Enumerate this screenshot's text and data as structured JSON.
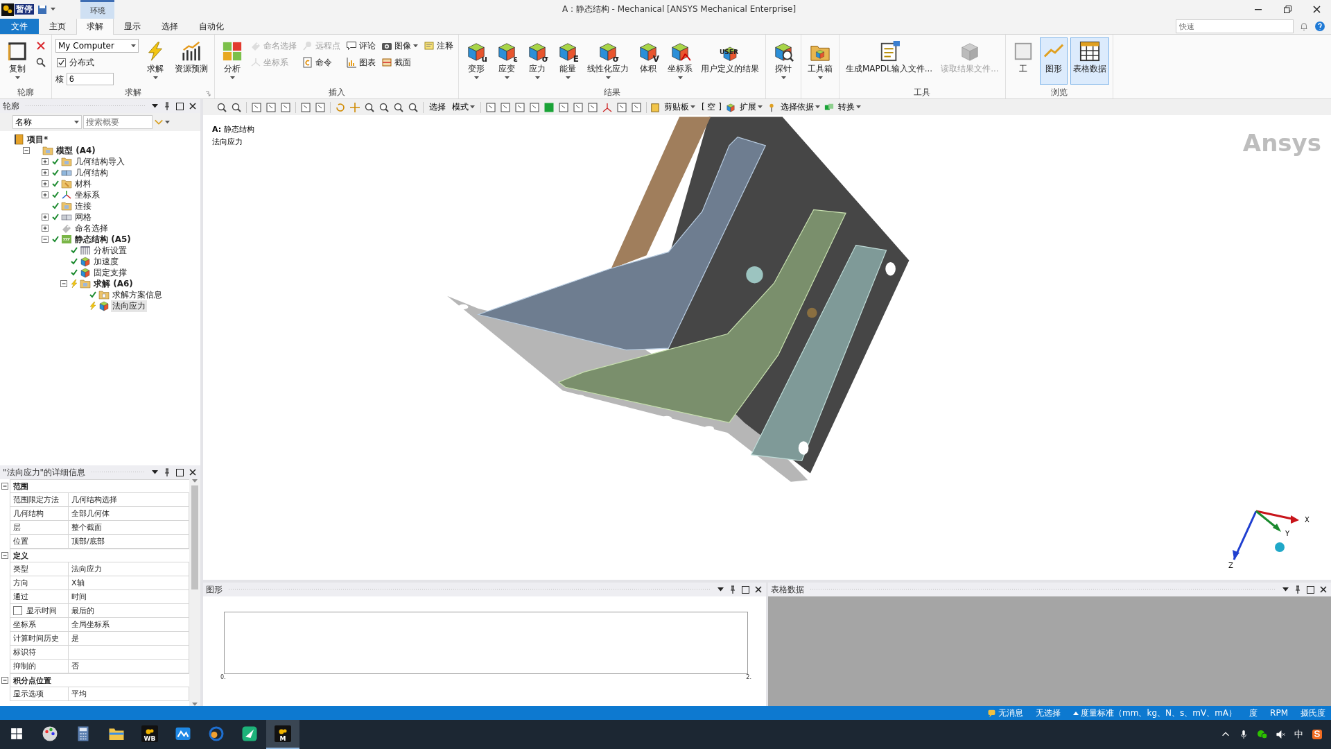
{
  "window": {
    "title": "A : 静态结构 - Mechanical [ANSYS Mechanical Enterprise]",
    "overlay_label": "暂停",
    "context_tab": "环境"
  },
  "ribbon_tabs": [
    {
      "label": "文件",
      "kind": "file",
      "selected": false
    },
    {
      "label": "主页",
      "kind": "tab",
      "selected": false
    },
    {
      "label": "求解",
      "kind": "tab",
      "selected": true
    },
    {
      "label": "显示",
      "kind": "tab",
      "selected": false
    },
    {
      "label": "选择",
      "kind": "tab",
      "selected": false
    },
    {
      "label": "自动化",
      "kind": "tab",
      "selected": false
    }
  ],
  "quick_search": {
    "placeholder": "快速"
  },
  "ribbon_groups": [
    {
      "title": "轮廓",
      "items": [
        {
          "kind": "large",
          "label": "复制",
          "caret": true,
          "disabled": false
        },
        {
          "kind": "stack",
          "items": [
            {
              "kind": "small",
              "disabled": false
            },
            {
              "kind": "small",
              "disabled": false
            }
          ]
        }
      ]
    },
    {
      "title": "求解",
      "launcher": true,
      "items": [
        {
          "kind": "stack",
          "items": [
            {
              "kind": "dropdown",
              "value": "My Computer"
            },
            {
              "kind": "checkbox",
              "label": "分布式",
              "checked": true
            },
            {
              "kind": "field",
              "label": "核",
              "value": "6"
            }
          ]
        },
        {
          "kind": "large",
          "label": "求解",
          "caret": true,
          "disabled": false
        },
        {
          "kind": "large",
          "label": "资源预测",
          "caret": false,
          "disabled": false
        }
      ]
    },
    {
      "title": "插入",
      "items": [
        {
          "kind": "large",
          "label": "分析",
          "caret": true,
          "disabled": false
        },
        {
          "kind": "stack",
          "items": [
            {
              "kind": "small",
              "label": "命名选择",
              "disabled": true
            },
            {
              "kind": "small",
              "label": "坐标系",
              "disabled": true
            }
          ]
        },
        {
          "kind": "stack",
          "items": [
            {
              "kind": "small",
              "label": "远程点",
              "disabled": true
            },
            {
              "kind": "small",
              "label": "命令",
              "disabled": false
            }
          ]
        },
        {
          "kind": "stack",
          "items": [
            {
              "kind": "small",
              "label": "评论",
              "disabled": false
            },
            {
              "kind": "small",
              "label": "图表",
              "disabled": false
            }
          ]
        },
        {
          "kind": "stack",
          "items": [
            {
              "kind": "small",
              "label": "图像",
              "caret": true,
              "disabled": false
            },
            {
              "kind": "small",
              "label": "截面",
              "disabled": false
            }
          ]
        },
        {
          "kind": "stack",
          "items": [
            {
              "kind": "small",
              "label": "注释",
              "disabled": false
            }
          ]
        }
      ]
    },
    {
      "title": "结果",
      "items": [
        {
          "kind": "large",
          "label": "变形",
          "symbol": "u",
          "caret": true,
          "disabled": false
        },
        {
          "kind": "large",
          "label": "应变",
          "symbol": "ε",
          "caret": true,
          "disabled": false
        },
        {
          "kind": "large",
          "label": "应力",
          "symbol": "σ",
          "caret": true,
          "disabled": false
        },
        {
          "kind": "large",
          "label": "能量",
          "symbol": "E",
          "caret": true,
          "disabled": false
        },
        {
          "kind": "large",
          "label": "线性化应力",
          "symbol": "σ",
          "caret": true,
          "disabled": false
        },
        {
          "kind": "large",
          "label": "体积",
          "symbol": "V",
          "caret": false,
          "disabled": false
        },
        {
          "kind": "large",
          "label": "坐标系",
          "caret": true,
          "disabled": false
        },
        {
          "kind": "large",
          "label": "用户定义的结果",
          "symbol": "USER",
          "caret": false,
          "disabled": false
        }
      ]
    },
    {
      "items": [
        {
          "kind": "large",
          "label": "探针",
          "caret": true,
          "disabled": false
        }
      ]
    },
    {
      "items": [
        {
          "kind": "large",
          "label": "工具箱",
          "caret": true,
          "disabled": false
        }
      ]
    },
    {
      "title": "工具",
      "items": [
        {
          "kind": "large",
          "label": "生成MAPDL输入文件...",
          "caret": false,
          "disabled": false
        },
        {
          "kind": "large",
          "label": "读取结果文件...",
          "caret": false,
          "disabled": true
        }
      ]
    },
    {
      "title": "浏览",
      "items": [
        {
          "kind": "large",
          "label": "工",
          "caret": false,
          "disabled": false,
          "selected": false
        },
        {
          "kind": "large",
          "label": "图形",
          "caret": false,
          "disabled": false,
          "selected": true
        },
        {
          "kind": "large",
          "label": "表格数据",
          "caret": false,
          "disabled": false,
          "selected": true
        }
      ]
    }
  ],
  "toolbar": [
    {
      "label": "选择",
      "caret": false
    },
    {
      "label": "模式",
      "caret": true
    },
    {
      "label": "剪贴板",
      "caret": true
    },
    {
      "label": "[ 空 ]",
      "caret": false
    },
    {
      "label": "扩展",
      "caret": true
    },
    {
      "label": "选择依据",
      "caret": true
    },
    {
      "label": "转换",
      "caret": true
    }
  ],
  "outline": {
    "title": "轮廓",
    "filter": "名称",
    "search_placeholder": "搜索概要"
  },
  "tree": {
    "label": "项目*",
    "bold": true,
    "done": false,
    "pending": false,
    "selected": false,
    "children": [
      {
        "label": "模型 (A4)",
        "bold": true,
        "done": false,
        "pending": false,
        "expanded": true,
        "selected": false,
        "children": [
          {
            "label": "几何结构导入",
            "bold": false,
            "done": true,
            "pending": false,
            "expanded": false,
            "selected": false
          },
          {
            "label": "几何结构",
            "bold": false,
            "done": true,
            "pending": false,
            "expanded": false,
            "selected": false
          },
          {
            "label": "材料",
            "bold": false,
            "done": true,
            "pending": false,
            "expanded": false,
            "selected": false
          },
          {
            "label": "坐标系",
            "bold": false,
            "done": true,
            "pending": false,
            "expanded": false,
            "selected": false
          },
          {
            "label": "连接",
            "bold": false,
            "done": true,
            "pending": false,
            "selected": false
          },
          {
            "label": "网格",
            "bold": false,
            "done": true,
            "pending": false,
            "expanded": false,
            "selected": false
          },
          {
            "label": "命名选择",
            "bold": false,
            "done": false,
            "pending": false,
            "expanded": false,
            "selected": false
          },
          {
            "label": "静态结构 (A5)",
            "bold": true,
            "done": true,
            "pending": false,
            "expanded": true,
            "selected": false,
            "children": [
              {
                "label": "分析设置",
                "bold": false,
                "done": true,
                "pending": false,
                "selected": false
              },
              {
                "label": "加速度",
                "bold": false,
                "done": true,
                "pending": false,
                "selected": false
              },
              {
                "label": "固定支撑",
                "bold": false,
                "done": true,
                "pending": false,
                "selected": false
              },
              {
                "label": "求解 (A6)",
                "bold": true,
                "done": false,
                "pending": true,
                "expanded": true,
                "selected": false,
                "children": [
                  {
                    "label": "求解方案信息",
                    "bold": false,
                    "done": true,
                    "pending": false,
                    "selected": false
                  },
                  {
                    "label": "法向应力",
                    "bold": false,
                    "done": false,
                    "pending": true,
                    "selected": true
                  }
                ]
              }
            ]
          }
        ]
      }
    ]
  },
  "details": {
    "title": "\"法向应力\"的详细信息",
    "sections": [
      {
        "title": "范围",
        "expanded": true,
        "rows": [
          {
            "kind": "plain",
            "label": "范围限定方法",
            "value": "几何结构选择"
          },
          {
            "kind": "plain",
            "label": "几何结构",
            "value": "全部几何体"
          },
          {
            "kind": "plain",
            "label": "层",
            "value": "整个截面"
          },
          {
            "kind": "plain",
            "label": "位置",
            "value": "顶部/底部"
          }
        ]
      },
      {
        "title": "定义",
        "expanded": true,
        "rows": [
          {
            "kind": "plain",
            "label": "类型",
            "value": "法向应力"
          },
          {
            "kind": "plain",
            "label": "方向",
            "value": "X轴"
          },
          {
            "kind": "plain",
            "label": "通过",
            "value": "时间"
          },
          {
            "kind": "checkbox",
            "label": "显示时间",
            "value": "最后的",
            "checked": false
          },
          {
            "kind": "plain",
            "label": "坐标系",
            "value": "全局坐标系"
          },
          {
            "kind": "plain",
            "label": "计算时间历史",
            "value": "是"
          },
          {
            "kind": "plain",
            "label": "标识符"
          },
          {
            "kind": "plain",
            "label": "抑制的",
            "value": "否"
          }
        ]
      },
      {
        "title": "积分点位置",
        "expanded": true,
        "rows": [
          {
            "kind": "plain",
            "label": "显示选项",
            "value": "平均"
          }
        ]
      }
    ]
  },
  "viewport": {
    "title": "**A:** 静态结构",
    "subtitle": "法向应力",
    "logo": "Ansys",
    "axes": [
      "X",
      "Y",
      "Z"
    ]
  },
  "graph_panel": {
    "title": "图形",
    "x_ticks": [
      "0.",
      "2."
    ]
  },
  "table_panel": {
    "title": "表格数据"
  },
  "status_bar": [
    {
      "text": "无消息"
    },
    {
      "text": "无选择"
    },
    {
      "text": "度量标准（mm、kg、N、s、mV、mA）"
    },
    {
      "text": "度"
    },
    {
      "text": "RPM"
    },
    {
      "text": "摄氏度"
    }
  ],
  "taskbar": {
    "apps": [
      {
        "selected": false
      },
      {
        "selected": false
      },
      {
        "selected": false
      },
      {
        "label": "WB",
        "selected": false
      },
      {
        "selected": false
      },
      {
        "selected": false
      },
      {
        "selected": false
      },
      {
        "label": "M",
        "selected": true
      }
    ],
    "ime": "中"
  }
}
